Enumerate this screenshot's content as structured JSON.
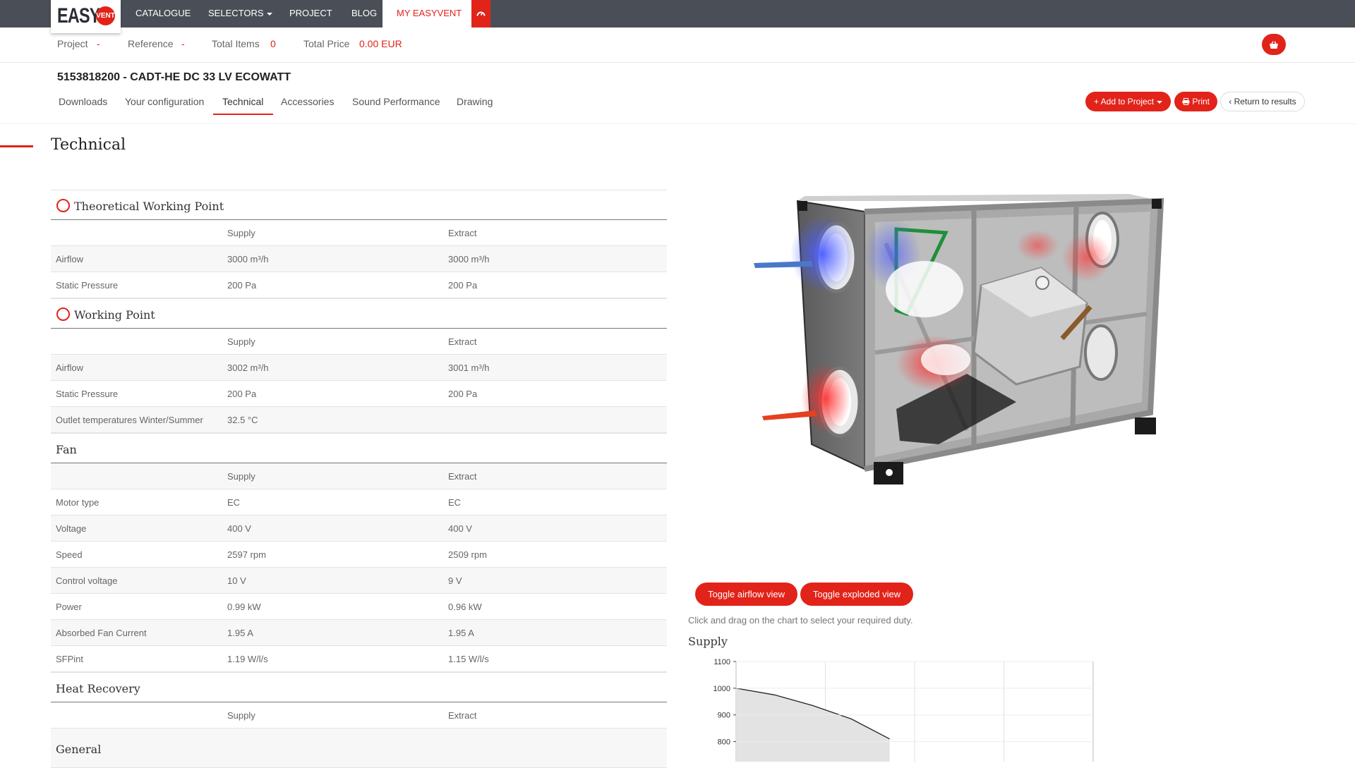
{
  "brand": {
    "logo_text": "EASY",
    "logo_badge": "VENT"
  },
  "nav": {
    "items": [
      {
        "label": "CATALOGUE"
      },
      {
        "label": "SELECTORS"
      },
      {
        "label": "PROJECT"
      },
      {
        "label": "BLOG"
      },
      {
        "label": "MY EASYVENT"
      }
    ],
    "icon": "dashboard-icon"
  },
  "project_bar": {
    "project_label": "Project",
    "project_value": "-",
    "reference_label": "Reference",
    "reference_value": "-",
    "total_items_label": "Total Items",
    "total_items_value": "0",
    "total_price_label": "Total Price",
    "total_price_value": "0.00 EUR",
    "basket_icon": "basket-icon"
  },
  "product": {
    "title": "5153818200 - CADT-HE DC 33 LV ECOWATT",
    "tabs": [
      "Downloads",
      "Your configuration",
      "Technical",
      "Accessories",
      "Sound Performance",
      "Drawing"
    ],
    "active_tab": "Technical",
    "add_to_project_label": "Add to Project",
    "print_label": "Print",
    "return_label": "Return to results"
  },
  "technical": {
    "heading": "Technical",
    "col_supply": "Supply",
    "col_extract": "Extract",
    "theoretical": {
      "title": "Theoretical Working Point",
      "rows": [
        {
          "label": "Airflow",
          "supply": "3000 m³/h",
          "extract": "3000 m³/h"
        },
        {
          "label": "Static Pressure",
          "supply": "200 Pa",
          "extract": "200 Pa"
        }
      ]
    },
    "working": {
      "title": "Working Point",
      "rows": [
        {
          "label": "Airflow",
          "supply": "3002 m³/h",
          "extract": "3001 m³/h"
        },
        {
          "label": "Static Pressure",
          "supply": "200 Pa",
          "extract": "200 Pa"
        },
        {
          "label": "Outlet temperatures Winter/Summer",
          "supply": "32.5 °C",
          "extract": ""
        }
      ]
    },
    "fan": {
      "title": "Fan",
      "rows": [
        {
          "label": "Motor type",
          "supply": "EC",
          "extract": "EC"
        },
        {
          "label": "Voltage",
          "supply": "400 V",
          "extract": "400 V"
        },
        {
          "label": "Speed",
          "supply": "2597 rpm",
          "extract": "2509 rpm"
        },
        {
          "label": "Control voltage",
          "supply": "10 V",
          "extract": "9 V"
        },
        {
          "label": "Power",
          "supply": "0.99 kW",
          "extract": "0.96 kW"
        },
        {
          "label": "Absorbed Fan Current",
          "supply": "1.95 A",
          "extract": "1.95 A"
        },
        {
          "label": "SFPint",
          "supply": "1.19 W/l/s",
          "extract": "1.15 W/l/s"
        }
      ]
    },
    "heat_recovery": {
      "title": "Heat Recovery"
    },
    "general": {
      "title": "General"
    }
  },
  "viewer": {
    "toggle_airflow_label": "Toggle airflow view",
    "toggle_exploded_label": "Toggle exploded view",
    "hint": "Click and drag on the chart to select your required duty.",
    "supply_heading": "Supply"
  },
  "chart_data": {
    "type": "area",
    "title": "Supply",
    "yticks": [
      1100,
      1000,
      900,
      800
    ],
    "ylim": [
      800,
      1100
    ],
    "series": [
      {
        "x": [
          0,
          0.25,
          0.5,
          0.75,
          1.0
        ],
        "values": [
          1000,
          975,
          935,
          885,
          810
        ]
      }
    ],
    "grid": true
  },
  "colors": {
    "accent": "#e2231a",
    "nav_bg": "#4a4f57"
  }
}
